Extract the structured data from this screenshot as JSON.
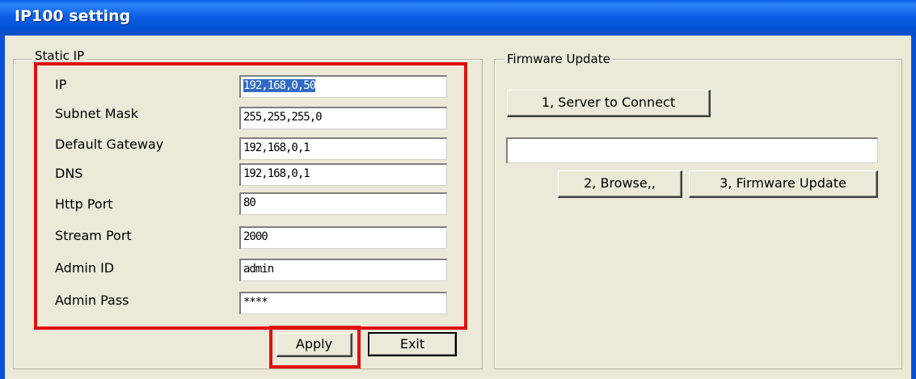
{
  "window": {
    "title": "IP100 setting"
  },
  "static_ip": {
    "group_label": "Static IP",
    "fields": [
      {
        "label": "IP",
        "value": "192,168,0,50",
        "selected": true
      },
      {
        "label": "Subnet Mask",
        "value": "255,255,255,0"
      },
      {
        "label": "Default Gateway",
        "value": "192,168,0,1"
      },
      {
        "label": "DNS",
        "value": "192,168,0,1"
      },
      {
        "label": "Http Port",
        "value": "80"
      },
      {
        "label": "Stream Port",
        "value": "2000"
      },
      {
        "label": "Admin ID",
        "value": "admin"
      },
      {
        "label": "Admin Pass",
        "value": "****"
      }
    ],
    "apply_label": "Apply",
    "exit_label": "Exit"
  },
  "firmware": {
    "group_label": "Firmware Update",
    "server_button": "1, Server to Connect",
    "path_value": "",
    "browse_button": "2, Browse,,",
    "update_button": "3, Firmware Update"
  },
  "highlight_color": "#e01010"
}
